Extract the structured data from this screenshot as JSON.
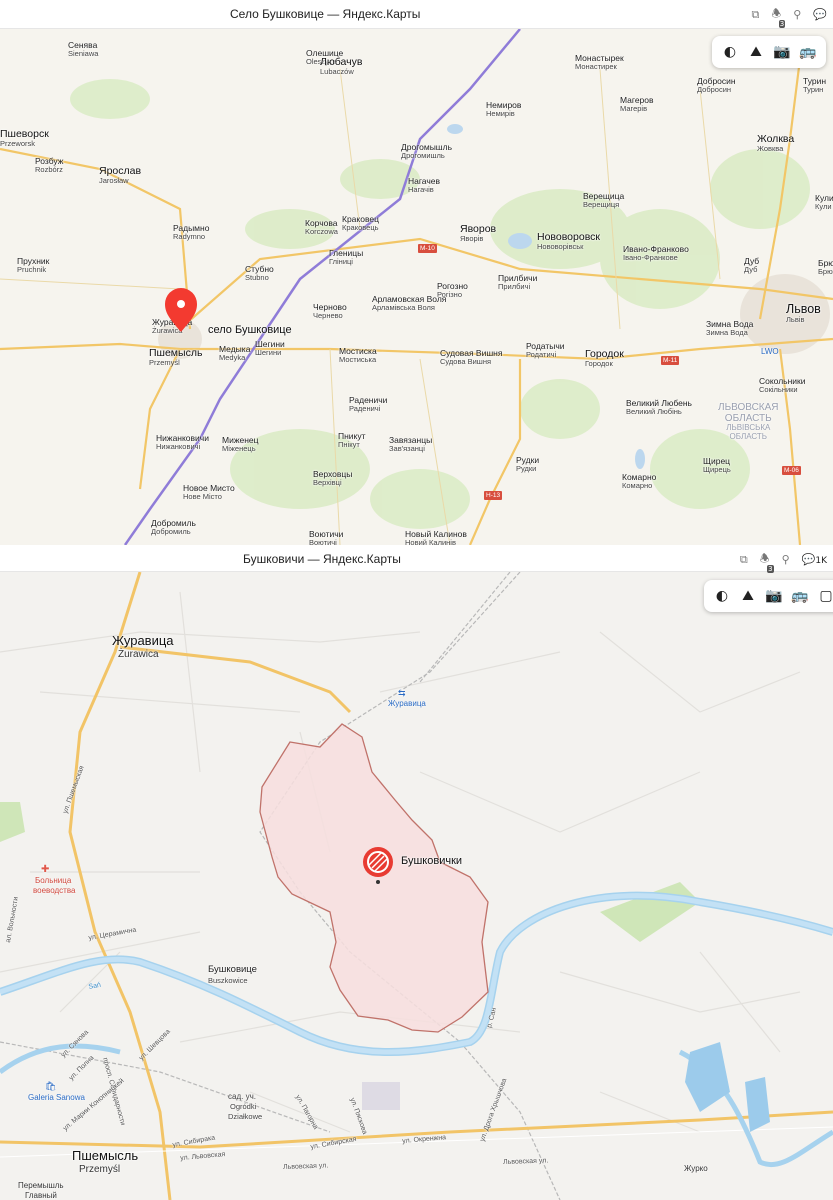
{
  "top": {
    "title": "Село Бушковице — Яндекс.Карты",
    "tab_icons": [
      "window-icon",
      "notifications-icon",
      "location-icon",
      "chat-icon"
    ],
    "notif_count": "3",
    "toolbar": [
      "layers-icon",
      "panorama-icon",
      "photo-icon",
      "transit-icon"
    ],
    "place_label": "село Бушковице",
    "labels": [
      {
        "m": "Сенява",
        "s": "Sieniawa"
      },
      {
        "m": "Олешице",
        "s": "Oleszyce"
      },
      {
        "m": "Любачув",
        "s": "Lubaczów"
      },
      {
        "m": "Монастырек",
        "s": "Монастирек"
      },
      {
        "m": "Добросин",
        "s": "Добросин"
      },
      {
        "m": "Турин",
        "s": "Турин"
      },
      {
        "m": "Пшеворск",
        "s": "Przeworsk"
      },
      {
        "m": "Немиров",
        "s": "Немирів"
      },
      {
        "m": "Магеров",
        "s": "Магерів"
      },
      {
        "m": "Жолква",
        "s": "Жовква"
      },
      {
        "m": "Розбуж",
        "s": "Rozbórz"
      },
      {
        "m": "Дрогомышль",
        "s": "Дрогомишль"
      },
      {
        "m": "Ярослав",
        "s": "Jarosław"
      },
      {
        "m": "Нагачев",
        "s": "Нагачів"
      },
      {
        "m": "Верещица",
        "s": "Верещиця"
      },
      {
        "m": "Кули",
        "s": "Кули"
      },
      {
        "m": "Радымно",
        "s": "Radymno"
      },
      {
        "m": "Корчова",
        "s": "Korczowa"
      },
      {
        "m": "Краковец",
        "s": "Краковець"
      },
      {
        "m": "Яворов",
        "s": "Яворів"
      },
      {
        "m": "Нововоровск",
        "s": "Нововорівськ"
      },
      {
        "m": "Ивано-Франково",
        "s": "Івано-Франкове"
      },
      {
        "m": "Прухник",
        "s": "Pruchnik"
      },
      {
        "m": "Гленицы",
        "s": "Гліниці"
      },
      {
        "m": "Стубно",
        "s": "Stubno"
      },
      {
        "m": "Прилбичи",
        "s": "Прилбичі"
      },
      {
        "m": "Брюховичи",
        "s": "Брюховичі"
      },
      {
        "m": "Дуб",
        "s": "Дуб"
      },
      {
        "m": "Рогозно",
        "s": "Рогізно"
      },
      {
        "m": "Черново",
        "s": "Чернево"
      },
      {
        "m": "Арламовская Воля",
        "s": "Арламівська Воля"
      },
      {
        "m": "Журавица",
        "s": "Żurawica"
      },
      {
        "m": "Зимна Вода",
        "s": "Зимна Вода"
      },
      {
        "m": "Львов",
        "s": "Львів"
      },
      {
        "m": "Медыка",
        "s": "Medyka"
      },
      {
        "m": "Шегини",
        "s": "Шегини"
      },
      {
        "m": "Мостиска",
        "s": "Мостиська"
      },
      {
        "m": "Судовая Вишня",
        "s": "Судова Вишня"
      },
      {
        "m": "Родатычи",
        "s": "Родатичі"
      },
      {
        "m": "Городок",
        "s": "Городок"
      },
      {
        "m": "Пшемысль",
        "s": "Przemyśl"
      },
      {
        "m": "Сокольники",
        "s": "Сокільники"
      },
      {
        "m": "Раденичи",
        "s": "Раденичі"
      },
      {
        "m": "Великий Любень",
        "s": "Великий Любінь"
      },
      {
        "m": "Нижанковичи",
        "s": "Нижанковичі"
      },
      {
        "m": "Миженец",
        "s": "Міженець"
      },
      {
        "m": "Пникут",
        "s": "Пнікут"
      },
      {
        "m": "Завязанцы",
        "s": "Зав'язанці"
      },
      {
        "m": "Щирец",
        "s": "Щирець"
      },
      {
        "m": "Рудки",
        "s": "Рудки"
      },
      {
        "m": "Верховцы",
        "s": "Верхівці"
      },
      {
        "m": "Новое Мисто",
        "s": "Нове Місто"
      },
      {
        "m": "Комарно",
        "s": "Комарно"
      },
      {
        "m": "Добромиль",
        "s": "Добромиль"
      },
      {
        "m": "Воютичи",
        "s": "Воютичі"
      },
      {
        "m": "Новый Калинов",
        "s": "Новий Калинів"
      }
    ],
    "region": [
      "ЛЬВОВСКАЯ",
      "ОБЛАСТЬ",
      "ЛЬВІВСЬКА",
      "ОБЛАСТЬ"
    ],
    "airport": "LWO",
    "roads": [
      "M-10",
      "M-11",
      "M-06",
      "H-13"
    ]
  },
  "bottom": {
    "title": "Бушковичи — Яндекс.Карты",
    "tab_icons": [
      "window-icon",
      "notifications-icon",
      "location-icon",
      "chat-icon"
    ],
    "notif_count": "3",
    "chat_count": "1K",
    "toolbar": [
      "layers-icon",
      "panorama-icon",
      "photo-icon",
      "transit-icon",
      "more-icon"
    ],
    "place_label": "Бушковички",
    "labels": {
      "zhuravica_m": "Журавица",
      "zhuravica_s": "Żurawica",
      "station": "Журавица",
      "hospital_1": "Больница",
      "hospital_2": "воеводства",
      "bushkovice_m": "Бушковице",
      "bushkovice_s": "Buszkowice",
      "przemysl_m": "Пшемысль",
      "przemysl_s": "Przemyśl",
      "garden_1": "сад. уч.",
      "garden_2": "Ogródki",
      "garden_3": "Działkowe",
      "galeria": "Galeria Sanowa",
      "station2_1": "Перемышль",
      "station2_2": "Главный",
      "hurko": "Журко"
    },
    "streets": [
      "ул. Пшемыская",
      "ал. Вольности",
      "ул. Церамична",
      "просп. Солидарности",
      "ул. Сибирака",
      "ул. Львовская",
      "Львовская ул.",
      "Львовская ул.",
      "ул. Окренжна",
      "ул. Пагорна",
      "ул. Пяскова",
      "ул. Сянова",
      "ул. Полна",
      "ул. Шевцова",
      "ул. Марии Конопницкей",
      "ул. Дрога Хрышчова",
      "ул. Сибирская",
      "р. Сан"
    ],
    "river_label": "Sań"
  }
}
